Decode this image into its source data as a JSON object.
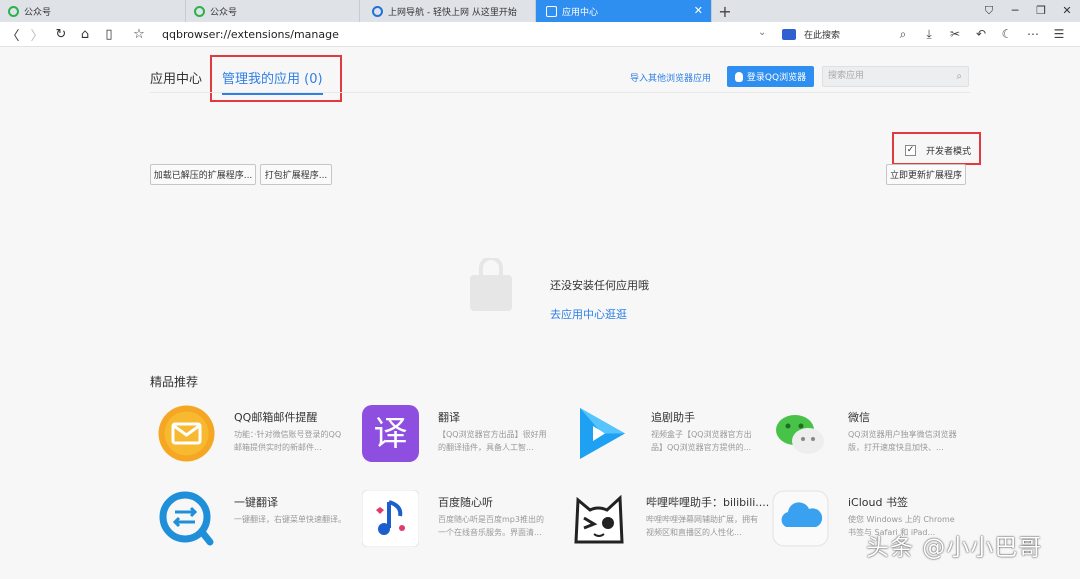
{
  "tabs": [
    {
      "title": "公众号",
      "icon": "wechat-official-icon",
      "active": false
    },
    {
      "title": "公众号",
      "icon": "wechat-official-icon",
      "active": false
    },
    {
      "title": "上网导航 - 轻快上网 从这里开始",
      "icon": "browser-icon",
      "active": false
    },
    {
      "title": "应用中心",
      "icon": "puzzle-icon",
      "active": true
    }
  ],
  "address_bar": {
    "url": "qqbrowser://extensions/manage",
    "search_engine_label": "在此搜索"
  },
  "page": {
    "title": "应用中心",
    "manage_tab": "管理我的应用 (0)",
    "import_link": "导入其他浏览器应用",
    "login_button": "登录QQ浏览器",
    "search_placeholder": "搜索应用",
    "dev_mode_label": "开发者模式",
    "dev_mode_checked": true,
    "load_unpacked_button": "加载已解压的扩展程序...",
    "pack_button": "打包扩展程序...",
    "update_button": "立即更新扩展程序",
    "empty_message": "还没安装任何应用哦",
    "empty_link": "去应用中心逛逛",
    "recommended_title": "精品推荐"
  },
  "recommended": [
    {
      "name": "QQ邮箱邮件提醒",
      "desc": "功能：·针对微信账号登录的QQ邮箱提供实时的新邮件...",
      "icon": "mail-icon",
      "color": "#f5a623"
    },
    {
      "name": "翻译",
      "desc": "【QQ浏览器官方出品】很好用的翻译插件，具备人工智...",
      "icon": "translate-icon",
      "color": "#8e4fe0"
    },
    {
      "name": "追剧助手",
      "desc": "视频盒子【QQ浏览器官方出品】QQ浏览器官方提供的...",
      "icon": "play-icon",
      "color": "#1ea1f2"
    },
    {
      "name": "微信",
      "desc": "QQ浏览器用户独享微信浏览器版，打开速度快且加快、...",
      "icon": "wechat-icon",
      "color": "#48c248"
    },
    {
      "name": "一键翻译",
      "desc": "一键翻译，右键菜单快速翻译。",
      "icon": "quick-translate-icon",
      "color": "#1e8fd8"
    },
    {
      "name": "百度随心听",
      "desc": "百度随心听是百度mp3推出的一个在线音乐服务。界面清...",
      "icon": "music-note-icon",
      "color": "#1a5fcc"
    },
    {
      "name": "哔哩哔哩助手：bilibili....",
      "desc": "哔哩哔哩弹幕网辅助扩展，拥有视频区和直播区的人性化...",
      "icon": "bilibili-cat-icon",
      "color": "#222222"
    },
    {
      "name": "iCloud 书签",
      "desc": "使您 Windows 上的 Chrome 书签与 Safari 和 iPad...",
      "icon": "cloud-icon",
      "color": "#3aa0f0"
    }
  ],
  "watermark": "头条 @小小巴哥"
}
